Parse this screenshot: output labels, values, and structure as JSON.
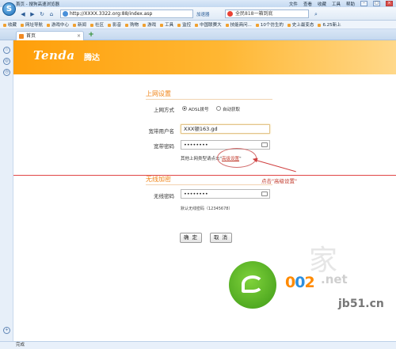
{
  "browser": {
    "title": "首页 - 搜狗高速浏览器",
    "menu": [
      "文件",
      "查看",
      "收藏",
      "工具",
      "帮助"
    ],
    "url": "http://XXXX.3322.org:88/index.asp",
    "accel_label": "加速器",
    "search_text": "全民818一箱到底",
    "favorites": [
      "收藏",
      "网址导航",
      "游戏中心",
      "新闻",
      "社区",
      "影音",
      "购物",
      "游戏",
      "工具",
      "监控",
      "中国联赛大",
      "技能商问...",
      "10个仿生的",
      "史上最变态",
      "6.25新上"
    ],
    "tab_label": "首页",
    "status": "完成"
  },
  "page": {
    "brand": "Tenda",
    "brand_cn": "腾达",
    "internet_section": "上网设置",
    "access_label": "上网方式",
    "option_adsl": "ADSL拨号",
    "option_auto": "自动获取",
    "user_label": "宽带用户名",
    "user_value": "XXX顿163.gd",
    "pass_label": "宽带密码",
    "pass_value": "••••••••",
    "hint_prefix": "其他上网类型请点击",
    "hint_link": "高级设置",
    "callout": "点击\"高级设置\"",
    "wireless_section": "无线加密",
    "wifi_pass_label": "无线密码",
    "wifi_pass_value": "••••••••",
    "default_pass": "默认无线密码（12345678）",
    "ok": "确 定",
    "cancel": "取 消"
  },
  "watermark": {
    "num_a": "0",
    "num_b": "0",
    "num_c": "2",
    "suffix": ".net",
    "cn": "jb51.cn"
  }
}
